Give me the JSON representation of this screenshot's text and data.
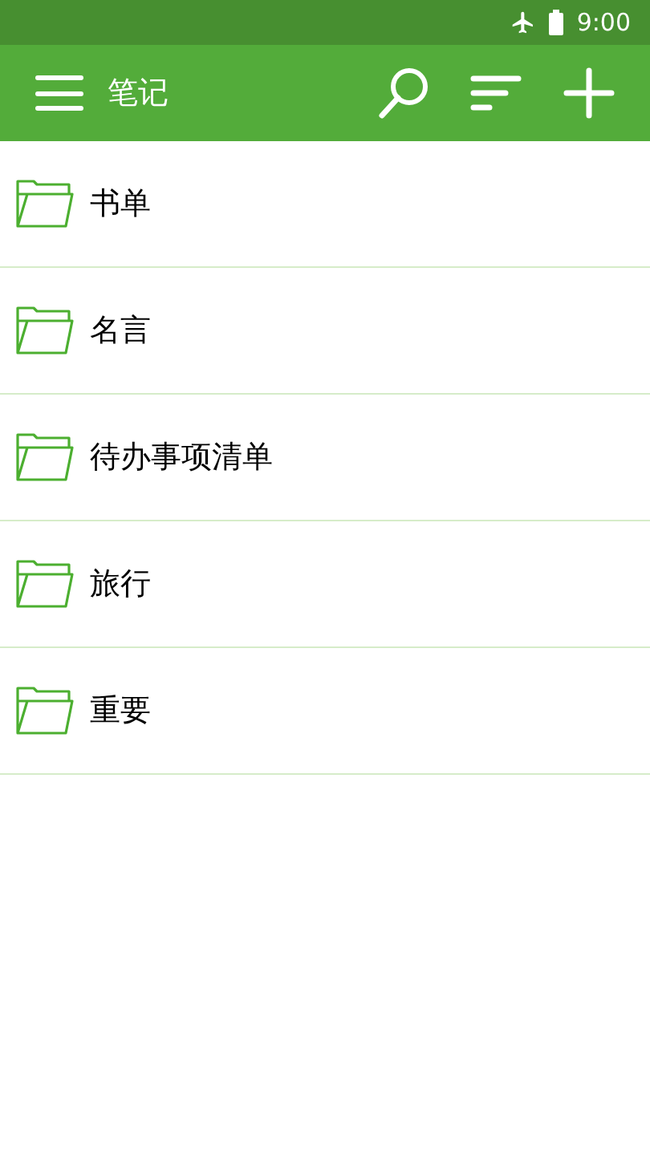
{
  "status_bar": {
    "time": "9:00"
  },
  "app_bar": {
    "title": "笔记"
  },
  "folders": [
    {
      "name": "书单"
    },
    {
      "name": "名言"
    },
    {
      "name": "待办事项清单"
    },
    {
      "name": "旅行"
    },
    {
      "name": "重要"
    }
  ]
}
